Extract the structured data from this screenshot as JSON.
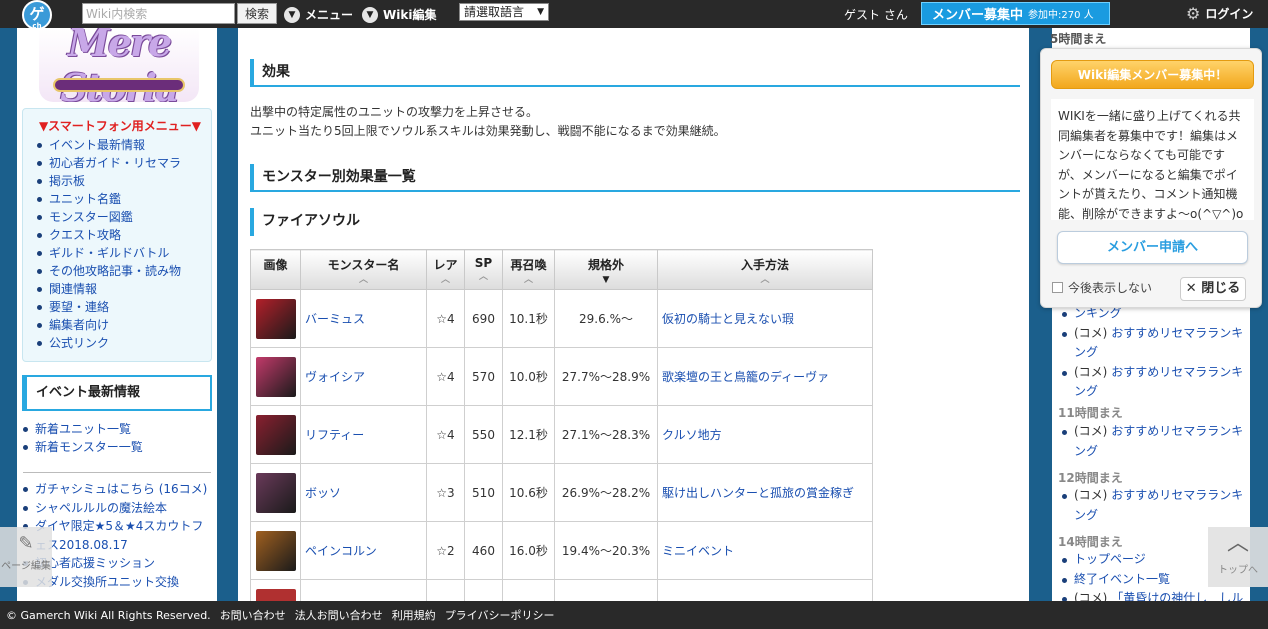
{
  "topbar": {
    "logo_text": "ゲ",
    "logo_sub": "ch",
    "search_placeholder": "Wiki内検索",
    "search_button": "検索",
    "menu_label": "メニュー",
    "wiki_edit_label": "Wiki編集",
    "language_select": "請選取語言",
    "guest_label": "ゲスト さん",
    "recruit_main": "メンバー募集中",
    "recruit_count": "参加中:270 人",
    "login_label": "ログイン"
  },
  "left_sidebar": {
    "logo_text": "Mere Storia",
    "sp_menu_title": "▼スマートフォン用メニュー▼",
    "sp_menu_items": [
      "イベント最新情報",
      "初心者ガイド・リセマラ",
      "掲示板",
      "ユニット名鑑",
      "モンスター図鑑",
      "クエスト攻略",
      "ギルド・ギルドバトル",
      "その他攻略記事・読み物",
      "関連情報",
      "要望・連絡",
      "編集者向け",
      "公式リンク"
    ],
    "event_heading": "イベント最新情報",
    "event_links": [
      "新着ユニット一覧",
      "新着モンスター一覧"
    ],
    "gacha_links": [
      "ガチャシミュはこちら (16コメ)",
      "シャペルルルの魔法絵本",
      "ダイヤ限定★5＆★4スカウトフェス2018.08.17",
      "初心者応援ミッション",
      "メダル交換所ユニット交換"
    ]
  },
  "main": {
    "effect_heading": "効果",
    "effect_lines": [
      "出撃中の特定属性のユニットの攻撃力を上昇させる。",
      "ユニット当たり5回上限でソウル系スキルは効果発動し、戦闘不能になるまで効果継続。"
    ],
    "list_heading": "モンスター別効果量一覧",
    "fire_heading": "ファイアソウル",
    "table_headers": [
      "画像",
      "モンスター名",
      "レア",
      "SP",
      "再召喚",
      "規格外",
      "入手方法"
    ],
    "rows": [
      {
        "name": "バーミュス",
        "rarity": "☆4",
        "sp": "690",
        "resummon": "10.1秒",
        "range": "29.6.%～",
        "source": "仮初の騎士と見えない瑕",
        "thumb_color": "#b3202a"
      },
      {
        "name": "ヴォイシア",
        "rarity": "☆4",
        "sp": "570",
        "resummon": "10.0秒",
        "range": "27.7%～28.9%",
        "source": "歌楽壇の王と鳥籠のディーヴァ",
        "thumb_color": "#c23a6a"
      },
      {
        "name": "リフティー",
        "rarity": "☆4",
        "sp": "550",
        "resummon": "12.1秒",
        "range": "27.1%～28.3%",
        "source": "クルソ地方",
        "thumb_color": "#8a2030"
      },
      {
        "name": "ボッソ",
        "rarity": "☆3",
        "sp": "510",
        "resummon": "10.6秒",
        "range": "26.9%～28.2%",
        "source": "駆け出しハンターと孤旅の賞金稼ぎ",
        "thumb_color": "#6a3a5a"
      },
      {
        "name": "ペインコルン",
        "rarity": "☆2",
        "sp": "460",
        "resummon": "16.0秒",
        "range": "19.4%～20.3%",
        "source": "ミニイベント",
        "thumb_color": "#a06020"
      }
    ]
  },
  "right_sidebar": {
    "tab_label": "5時間まえ",
    "groups": [
      {
        "items": [
          {
            "prefix": "",
            "text": "ンキング"
          },
          {
            "prefix": "(コメ) ",
            "text": "おすすめリセマラランキング"
          },
          {
            "prefix": "(コメ) ",
            "text": "おすすめリセマラランキング"
          }
        ]
      },
      {
        "time": "11時間まえ",
        "items": [
          {
            "prefix": "(コメ) ",
            "text": "おすすめリセマラランキング"
          }
        ]
      },
      {
        "time": "12時間まえ",
        "items": [
          {
            "prefix": "(コメ) ",
            "text": "おすすめリセマラランキング"
          }
        ]
      },
      {
        "time": "14時間まえ",
        "items": [
          {
            "prefix": "",
            "text": "トップページ"
          },
          {
            "prefix": "",
            "text": "終了イベント一覧"
          },
          {
            "prefix": "(コメ) ",
            "text": "「黄昏けの神仕し　しル"
          }
        ]
      }
    ]
  },
  "popup": {
    "badge": "Wiki編集メンバー募集中！",
    "body": "WIKIを一緒に盛り上げてくれる共同編集者を募集中です！編集はメンバーにならなくても可能ですが、メンバーになると編集でポイントが貰えたり、コメント通知機能、削除ができますよ～o(^▽^)o",
    "apply_button": "メンバー申請へ",
    "checkbox_label": "今後表示しない",
    "close_button": "✕ 閉じる"
  },
  "floating": {
    "page_edit": "ページ編集",
    "page_top": "トップへ"
  },
  "footer": {
    "items": [
      "© Gamerch Wiki All Rights Reserved.",
      "お問い合わせ",
      "法人お問い合わせ",
      "利用規約",
      "プライバシーポリシー"
    ]
  }
}
